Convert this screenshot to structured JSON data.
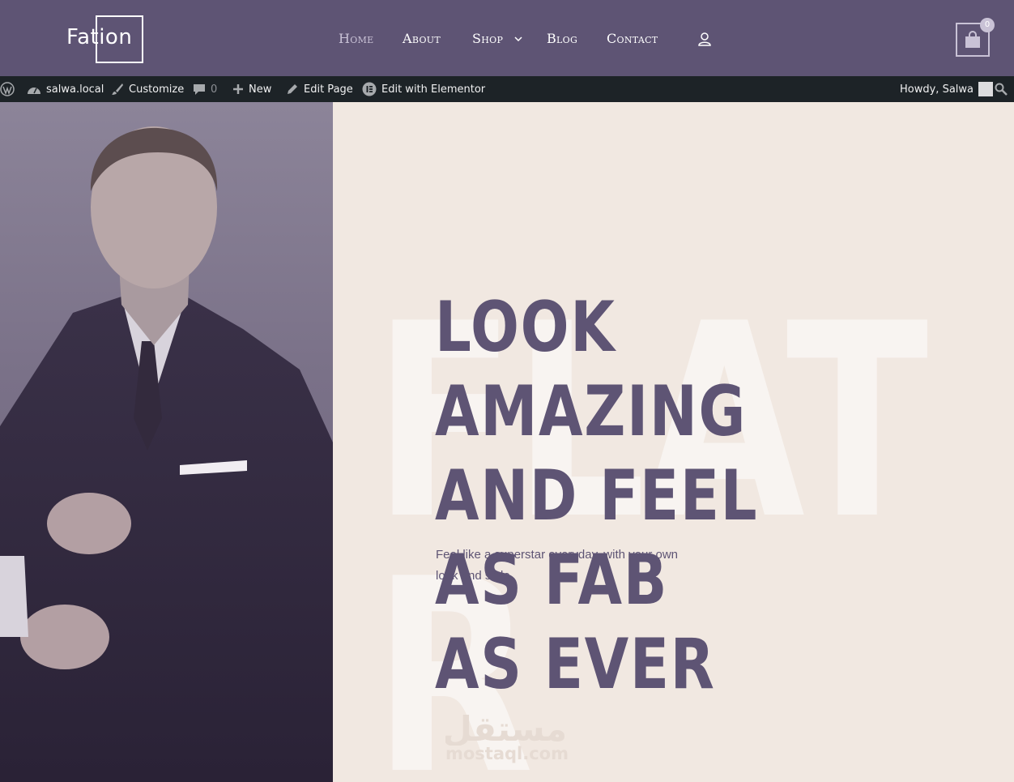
{
  "header": {
    "logo_text": "Fation",
    "nav": [
      {
        "label": "Home",
        "active": true
      },
      {
        "label": "About",
        "active": false
      },
      {
        "label": "Shop",
        "active": false,
        "has_dropdown": true
      },
      {
        "label": "Blog",
        "active": false
      },
      {
        "label": "Contact",
        "active": false
      }
    ],
    "cart_count": "0",
    "colors": {
      "header_bg": "#5e5474",
      "nav_active": "#c9c2d6",
      "accent": "#5e5474"
    }
  },
  "admin_bar": {
    "site_name": "salwa.local",
    "customize": "Customize",
    "comments_count": "0",
    "new": "New",
    "edit_page": "Edit Page",
    "edit_elementor": "Edit with Elementor",
    "howdy": "Howdy, Salwa"
  },
  "hero": {
    "headline_lines": [
      "LOOK AMAZING",
      "AND FEEL AS FAB",
      "AS EVER"
    ],
    "subtext": "Feel like a superstar everyday, with your own look and style",
    "background_word_1": "FLAT",
    "background_word_2": "R",
    "image_description_icon": "portrait-image"
  },
  "watermark": {
    "arabic": "مستقل",
    "latin": "mostaql.com"
  }
}
